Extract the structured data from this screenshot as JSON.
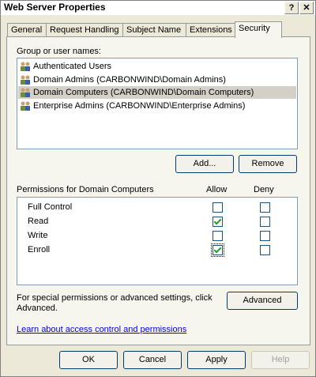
{
  "window": {
    "title": "Web Server Properties",
    "help_glyph": "?",
    "close_glyph": "✕"
  },
  "tabs": [
    {
      "label": "General",
      "active": false
    },
    {
      "label": "Request Handling",
      "active": false
    },
    {
      "label": "Subject Name",
      "active": false
    },
    {
      "label": "Extensions",
      "active": false
    },
    {
      "label": "Security",
      "active": true
    }
  ],
  "security": {
    "group_label": "Group or user names:",
    "users": [
      {
        "name": "Authenticated Users",
        "icon": "group-icon",
        "selected": false
      },
      {
        "name": "Domain Admins (CARBONWIND\\Domain Admins)",
        "icon": "group-icon",
        "selected": false
      },
      {
        "name": "Domain Computers (CARBONWIND\\Domain Computers)",
        "icon": "group-icon",
        "selected": true
      },
      {
        "name": "Enterprise Admins (CARBONWIND\\Enterprise Admins)",
        "icon": "group-icon",
        "selected": false
      }
    ],
    "add_label": "Add...",
    "remove_label": "Remove",
    "permissions_label": "Permissions for Domain Computers",
    "allow_header": "Allow",
    "deny_header": "Deny",
    "permissions": [
      {
        "name": "Full Control",
        "allow": false,
        "deny": false
      },
      {
        "name": "Read",
        "allow": true,
        "deny": false
      },
      {
        "name": "Write",
        "allow": false,
        "deny": false
      },
      {
        "name": "Enroll",
        "allow": true,
        "deny": false
      }
    ],
    "special_text_1": "For special permissions or advanced settings, click",
    "special_text_2": "Advanced.",
    "advanced_label": "Advanced",
    "learn_link": "Learn about access control and permissions"
  },
  "footer": {
    "ok": "OK",
    "cancel": "Cancel",
    "apply": "Apply",
    "help": "Help"
  },
  "colors": {
    "accent_link": "#0000ff",
    "check": "#21a121",
    "selection": "#d4d0c8"
  }
}
